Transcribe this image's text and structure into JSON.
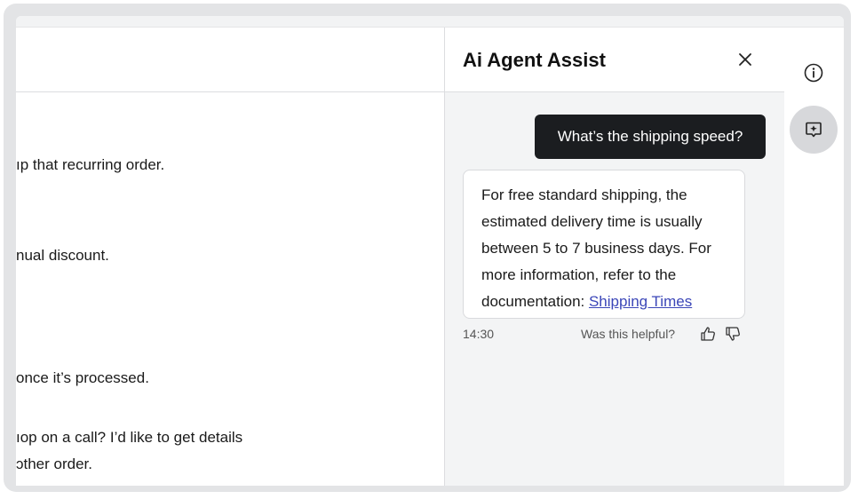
{
  "conversation": {
    "lines": [
      "ıp that recurring order.",
      "nual discount.",
      "once it’s processed.",
      "ıop on a call? I’d like to get details",
      "ɔther order."
    ]
  },
  "assist": {
    "title": "Ai Agent Assist",
    "user_message": "What’s the shipping speed?",
    "response_text": "For free standard shipping, the estimated delivery time is usually between 5 to 7 business days. For more information, refer to the documentation: ",
    "response_link": "Shipping Times",
    "timestamp": "14:30",
    "helpful_prompt": "Was this helpful?"
  },
  "rail": {
    "icons": [
      "info-icon",
      "agent-assist-icon"
    ]
  },
  "colors": {
    "user_bubble": "#1b1d20",
    "panel_bg": "#f3f4f5",
    "link": "#3b46b8",
    "active_rail": "#d7d8db"
  }
}
